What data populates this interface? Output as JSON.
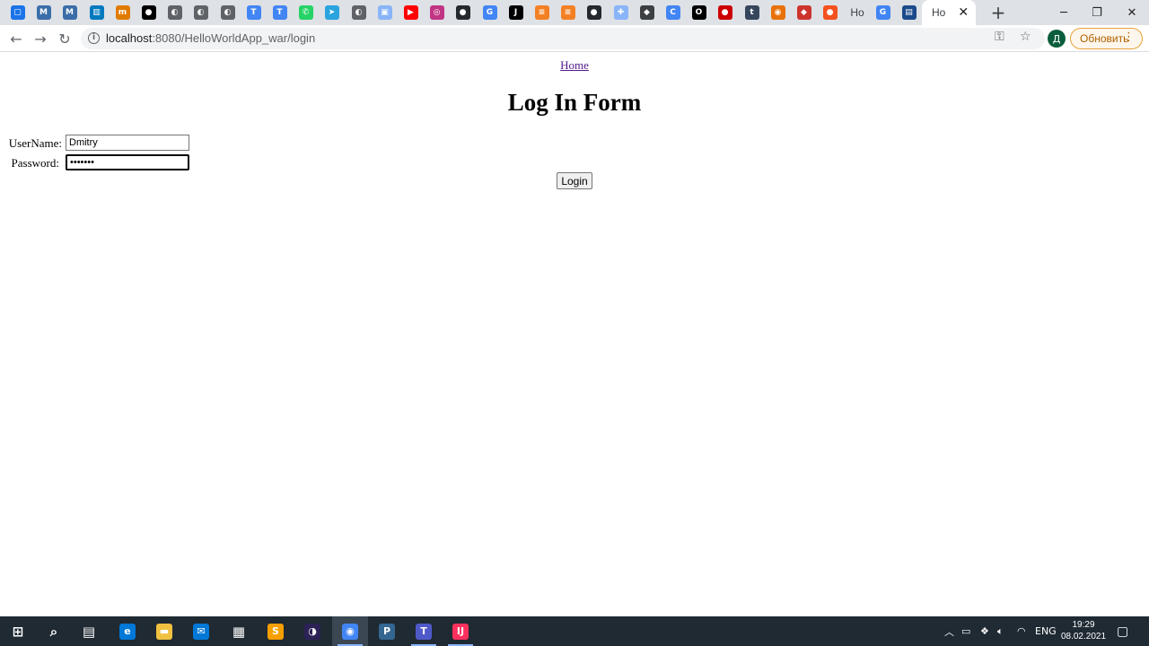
{
  "browser": {
    "tabs": [
      {
        "icon": "chat-icon",
        "color": "#1a73e8",
        "glyph": "▢"
      },
      {
        "icon": "mvn-icon",
        "color": "#3b6ea8",
        "glyph": "M"
      },
      {
        "icon": "mvn-icon",
        "color": "#3b6ea8",
        "glyph": "M"
      },
      {
        "icon": "trello-icon",
        "color": "#0079bf",
        "glyph": "▥"
      },
      {
        "icon": "site-icon",
        "color": "#e07b00",
        "glyph": "m"
      },
      {
        "icon": "medium-icon",
        "color": "#000000",
        "glyph": "●"
      },
      {
        "icon": "globe-icon",
        "color": "#5f6368",
        "glyph": "◐"
      },
      {
        "icon": "globe-icon",
        "color": "#5f6368",
        "glyph": "◐"
      },
      {
        "icon": "globe-icon",
        "color": "#5f6368",
        "glyph": "◐"
      },
      {
        "icon": "translate-icon",
        "color": "#4285f4",
        "glyph": "T"
      },
      {
        "icon": "translate-icon",
        "color": "#4285f4",
        "glyph": "T"
      },
      {
        "icon": "whatsapp-icon",
        "color": "#25d366",
        "glyph": "✆"
      },
      {
        "icon": "telegram-icon",
        "color": "#2aa3df",
        "glyph": "➤"
      },
      {
        "icon": "globe-icon",
        "color": "#5f6368",
        "glyph": "◐"
      },
      {
        "icon": "image-icon",
        "color": "#8ab4f8",
        "glyph": "▣"
      },
      {
        "icon": "youtube-icon",
        "color": "#ff0000",
        "glyph": "▶"
      },
      {
        "icon": "instagram-icon",
        "color": "#c13584",
        "glyph": "◎"
      },
      {
        "icon": "github-icon",
        "color": "#24292e",
        "glyph": "●"
      },
      {
        "icon": "google-icon",
        "color": "#4285f4",
        "glyph": "G"
      },
      {
        "icon": "jetbrains-icon",
        "color": "#000000",
        "glyph": "J"
      },
      {
        "icon": "stackoverflow-icon",
        "color": "#f48024",
        "glyph": "≡"
      },
      {
        "icon": "stackoverflow-icon",
        "color": "#f48024",
        "glyph": "≡"
      },
      {
        "icon": "github-icon",
        "color": "#24292e",
        "glyph": "●"
      },
      {
        "icon": "puzzle-icon",
        "color": "#8ab4f8",
        "glyph": "✚"
      },
      {
        "icon": "game-icon",
        "color": "#3c4043",
        "glyph": "◆"
      },
      {
        "icon": "cb-icon",
        "color": "#4285f4",
        "glyph": "C"
      },
      {
        "icon": "opera-icon",
        "color": "#000000",
        "glyph": "O"
      },
      {
        "icon": "redhat-icon",
        "color": "#cc0000",
        "glyph": "●"
      },
      {
        "icon": "tumblr-icon",
        "color": "#36465d",
        "glyph": "t"
      },
      {
        "icon": "tool-icon",
        "color": "#e8710a",
        "glyph": "◉"
      },
      {
        "icon": "ruby-icon",
        "color": "#cc342d",
        "glyph": "◆"
      },
      {
        "icon": "orange-icon",
        "color": "#f4511e",
        "glyph": "●"
      },
      {
        "icon": "page-icon",
        "color": "#5f6368",
        "glyph": "",
        "text": "Ho"
      },
      {
        "icon": "google-icon",
        "color": "#4285f4",
        "glyph": "G"
      },
      {
        "icon": "doc-icon",
        "color": "#1a4a8a",
        "glyph": "▤"
      },
      {
        "icon": "page-icon",
        "color": "#5f6368",
        "glyph": "",
        "text": "Ho",
        "active": true
      }
    ],
    "url_host": "localhost",
    "url_path": ":8080/HelloWorldApp_war/login",
    "avatar_letter": "Д",
    "update_label": "Обновить"
  },
  "page": {
    "home_link": "Home",
    "title": "Log In Form",
    "username_label": "UserName:",
    "username_value": "Dmitry",
    "password_label": "Password:",
    "password_value": "•••••••",
    "login_button": "Login"
  },
  "taskbar": {
    "apps": [
      {
        "icon": "windows-start-icon",
        "color": "#ffffff",
        "glyph": "⊞"
      },
      {
        "icon": "search-icon",
        "color": "#ffffff",
        "glyph": "⌕"
      },
      {
        "icon": "task-view-icon",
        "color": "#ffffff",
        "glyph": "▤"
      },
      {
        "icon": "edge-icon",
        "color": "#0078d7",
        "glyph": "e"
      },
      {
        "icon": "file-explorer-icon",
        "color": "#f0c040",
        "glyph": "▬"
      },
      {
        "icon": "mail-icon",
        "color": "#0078d7",
        "glyph": "✉"
      },
      {
        "icon": "store-icon",
        "color": "#ffffff",
        "glyph": "▦"
      },
      {
        "icon": "sublime-icon",
        "color": "#f59f00",
        "glyph": "S"
      },
      {
        "icon": "eclipse-icon",
        "color": "#2c2255",
        "glyph": "◑"
      },
      {
        "icon": "chrome-icon",
        "color": "#4285f4",
        "glyph": "◉",
        "running": true,
        "active": true
      },
      {
        "icon": "postgres-icon",
        "color": "#336791",
        "glyph": "P"
      },
      {
        "icon": "teams-icon",
        "color": "#5059c9",
        "glyph": "T",
        "running": true
      },
      {
        "icon": "intellij-icon",
        "color": "#fe315d",
        "glyph": "IJ",
        "running": true
      }
    ],
    "language": "ENG",
    "time": "19:29",
    "date": "08.02.2021"
  }
}
